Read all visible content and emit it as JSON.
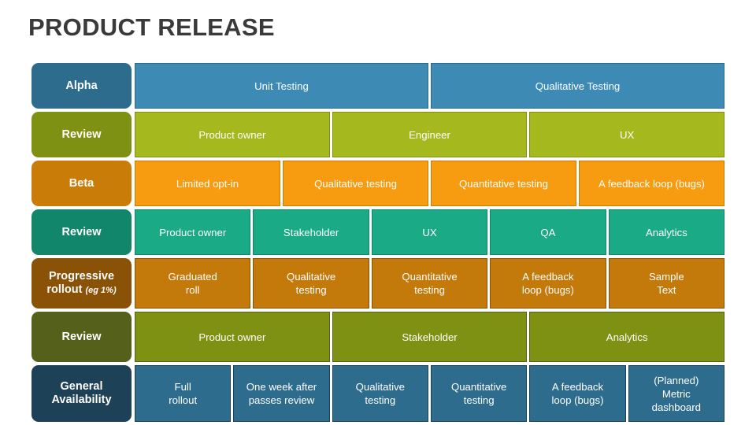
{
  "slide": {
    "title": "PRODUCT RELEASE",
    "title_color": "#3a3a3a",
    "background": "#ffffff"
  },
  "rows": [
    {
      "label": "Alpha",
      "label_sub": "",
      "label_color": "#2e6c8e",
      "cell_color": "#3d8bb5",
      "cell_border": "#2e6c8e",
      "height": "h-std",
      "cells": [
        "Unit Testing",
        "Qualitative Testing"
      ]
    },
    {
      "label": "Review",
      "label_sub": "",
      "label_color": "#7e9112",
      "cell_color": "#a5b91f",
      "cell_border": "#7e9112",
      "height": "h-std",
      "cells": [
        "Product owner",
        "Engineer",
        "UX"
      ]
    },
    {
      "label": "Beta",
      "label_sub": "",
      "label_color": "#c97d08",
      "cell_color": "#f79b10",
      "cell_border": "#c97d08",
      "height": "h-std",
      "cells": [
        "Limited opt-in",
        "Qualitative testing",
        "Quantitative testing",
        "A feedback loop (bugs)"
      ]
    },
    {
      "label": "Review",
      "label_sub": "",
      "label_color": "#12866a",
      "cell_color": "#1aaa85",
      "cell_border": "#12866a",
      "height": "h-std",
      "cells": [
        "Product owner",
        "Stakeholder",
        "UX",
        "QA",
        "Analytics"
      ]
    },
    {
      "label": "Progressive rollout",
      "label_sub": "(eg 1%)",
      "label_color": "#8a5206",
      "cell_color": "#c4790b",
      "cell_border": "#8a5206",
      "height": "h-tall",
      "cells": [
        "Graduated\nroll",
        "Qualitative\ntesting",
        "Quantitative\ntesting",
        "A feedback\nloop (bugs)",
        "Sample\nText"
      ]
    },
    {
      "label": "Review",
      "label_sub": "",
      "label_color": "#55611a",
      "cell_color": "#7e9112",
      "cell_border": "#55611a",
      "height": "h-tall",
      "cells": [
        "Product owner",
        "Stakeholder",
        "Analytics"
      ]
    },
    {
      "label": "General Availability",
      "label_sub": "",
      "label_color": "#1d4257",
      "cell_color": "#2e6c8e",
      "cell_border": "#1d4257",
      "height": "h-xtall",
      "cells": [
        "Full\nrollout",
        "One week after\npasses review",
        "Qualitative\ntesting",
        "Quantitative\ntesting",
        "A feedback\nloop (bugs)",
        "(Planned)\nMetric\ndashboard"
      ]
    }
  ]
}
